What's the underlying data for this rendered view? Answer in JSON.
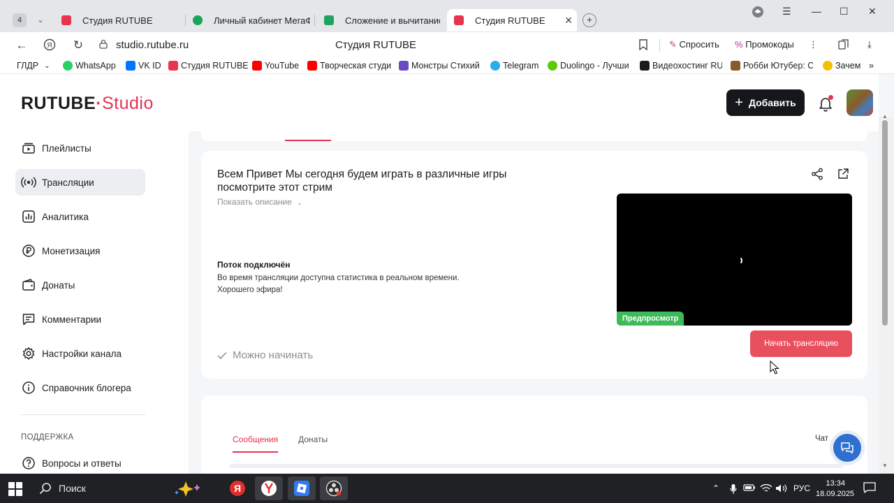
{
  "browser": {
    "tab_count": "4",
    "tabs": [
      {
        "label": "Студия RUTUBE",
        "color": "#e8344e"
      },
      {
        "label": "Личный кабинет МегаФо",
        "color": "#19a55a"
      },
      {
        "label": "Сложение и вычитание тр",
        "color": "#1da462"
      },
      {
        "label": "Студия RUTUBE",
        "color": "#e8344e",
        "active": true
      }
    ],
    "url": "studio.rutube.ru",
    "page_title": "Студия RUTUBE",
    "actions": {
      "ask": "Спросить",
      "promo": "Промокоды"
    },
    "bookmarks": [
      {
        "label": "ГЛДР",
        "color": "#ffffff"
      },
      {
        "label": "WhatsApp",
        "color": "#25d366"
      },
      {
        "label": "VK ID",
        "color": "#0077ff"
      },
      {
        "label": "Студия RUTUBE",
        "color": "#e8344e"
      },
      {
        "label": "YouTube",
        "color": "#ff0000"
      },
      {
        "label": "Творческая студи",
        "color": "#ff0000"
      },
      {
        "label": "Монстры Стихий",
        "color": "#6a4cbf"
      },
      {
        "label": "Telegram",
        "color": "#2aabee"
      },
      {
        "label": "Duolingo - Лучши",
        "color": "#58cc02"
      },
      {
        "label": "Видеохостинг RU",
        "color": "#1b1b1b"
      },
      {
        "label": "Робби Ютубер: С",
        "color": "#8b5a2b"
      },
      {
        "label": "Зачем",
        "color": "#f2c200"
      }
    ]
  },
  "studio": {
    "logo_main": "RUTUBE",
    "logo_sub": "Studio",
    "add_button": "Добавить",
    "sidebar": [
      {
        "label": "Плейлисты",
        "icon": "playlist-icon"
      },
      {
        "label": "Трансляции",
        "icon": "broadcast-icon",
        "active": true
      },
      {
        "label": "Аналитика",
        "icon": "analytics-icon"
      },
      {
        "label": "Монетизация",
        "icon": "ruble-icon"
      },
      {
        "label": "Донаты",
        "icon": "wallet-icon"
      },
      {
        "label": "Комментарии",
        "icon": "comment-icon"
      },
      {
        "label": "Настройки канала",
        "icon": "gear-icon"
      },
      {
        "label": "Справочник блогера",
        "icon": "info-icon"
      }
    ],
    "support_section": "ПОДДЕРЖКА",
    "support_item": "Вопросы и ответы",
    "stream": {
      "title": "Всем Привет Мы сегодня будем играть в различные игры посмотрите этот стрим",
      "show_description": "Показать описание",
      "connected_title": "Поток подключён",
      "connected_text_1": "Во время трансляции доступна статистика в реальном времени.",
      "connected_text_2": "Хорошего эфира!",
      "ready_status": "Можно начинать",
      "preview_badge": "Предпросмотр",
      "start_button": "Начать трансляцию"
    },
    "chat": {
      "tab_messages": "Сообщения",
      "tab_donations": "Донаты",
      "toggle_label": "Чат"
    }
  },
  "taskbar": {
    "search_placeholder": "Поиск",
    "language": "РУС",
    "time": "13:34",
    "date": "18.09.2025"
  },
  "colors": {
    "accent": "#e63252",
    "start_button": "#e8505e",
    "preview_badge": "#3dba5a"
  }
}
